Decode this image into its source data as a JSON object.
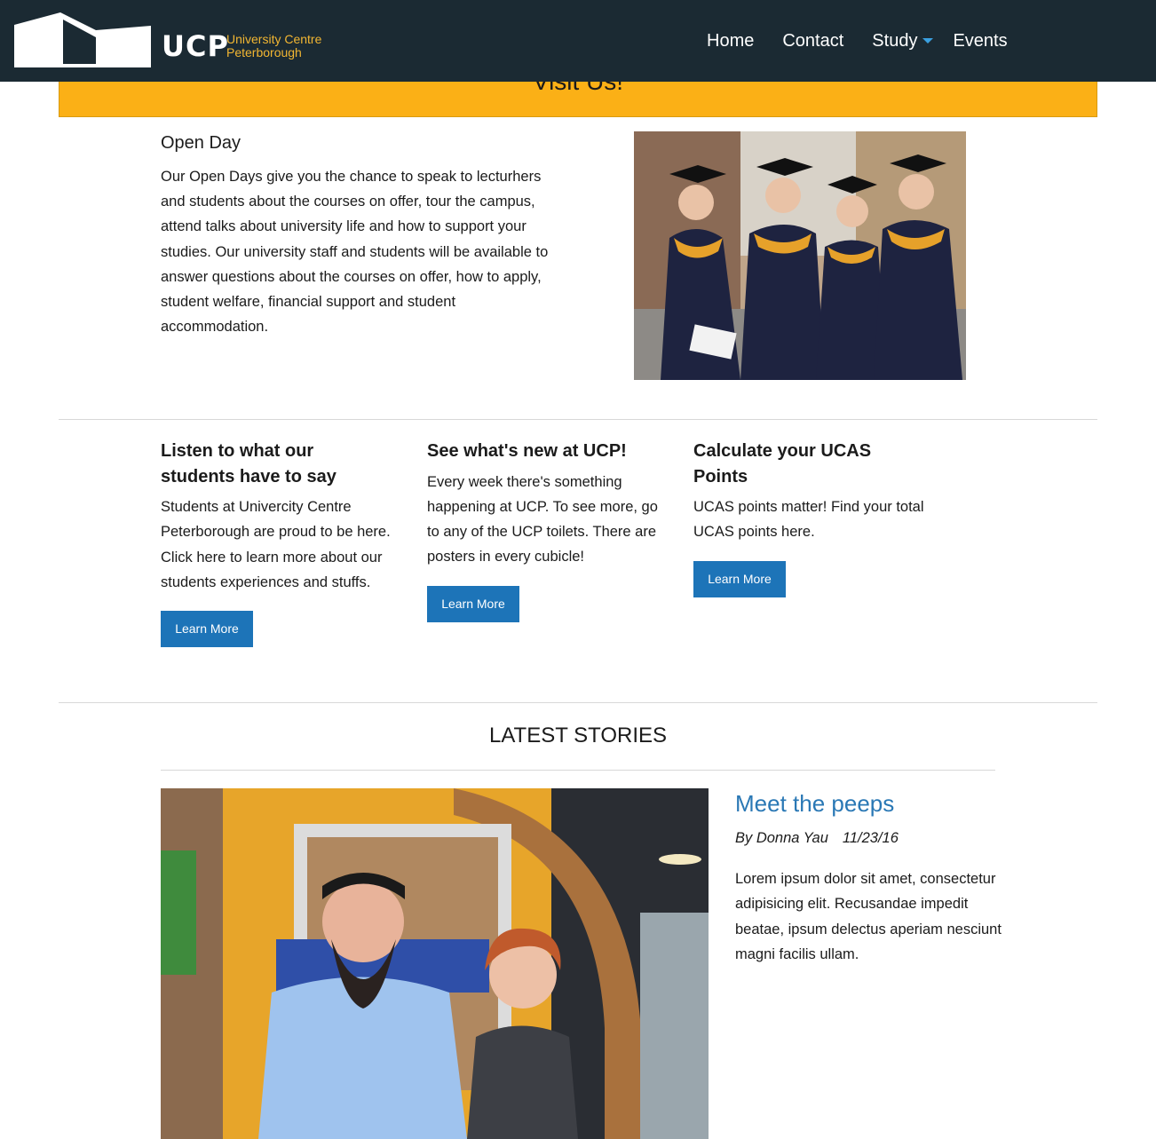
{
  "header": {
    "logo_wordmark": "UCP",
    "logo_tagline_line1": "University Centre",
    "logo_tagline_line2": "Peterborough",
    "nav": [
      {
        "label": "Home"
      },
      {
        "label": "Contact"
      },
      {
        "label": "Study"
      },
      {
        "label": "Events"
      }
    ]
  },
  "banner": {
    "title": "Visit Us!"
  },
  "open_day": {
    "title": "Open Day",
    "text": "Our Open Days give you the chance to speak to lecturhers and students about the courses on offer, tour the campus, attend talks about university life and how to support your studies. Our university staff and students will be available to answer questions about the courses on offer, how to apply, student welfare, financial support and student accommodation."
  },
  "columns": [
    {
      "title": "Listen to what our students have to say",
      "text": "Students at Univercity Centre Peterborough are proud to be here. Click here to learn more about our students experiences and stuffs.",
      "button_label": "Learn More"
    },
    {
      "title": "See what's new at UCP!",
      "text": "Every week there's something happening at UCP. To see more, go to any of the UCP toilets. There are posters in every cubicle!",
      "button_label": "Learn More"
    },
    {
      "title": "Calculate your UCAS Points",
      "text": "UCAS points matter! Find your total UCAS points here.",
      "button_label": "Learn More"
    }
  ],
  "stories": {
    "section_title": "LATEST STORIES",
    "items": [
      {
        "heading": "Meet the peeps",
        "author": "By Donna Yau",
        "date": "11/23/16",
        "text": "Lorem ipsum dolor sit amet, consectetur adipisicing elit. Recusandae impedit beatae, ipsum delectus aperiam nesciunt magni facilis ullam."
      }
    ]
  },
  "colors": {
    "header_bg": "#1b2a33",
    "banner_bg": "#fbb016",
    "button_bg": "#1d74b8",
    "link": "#2a78b5",
    "logo_accent": "#f2b632"
  }
}
